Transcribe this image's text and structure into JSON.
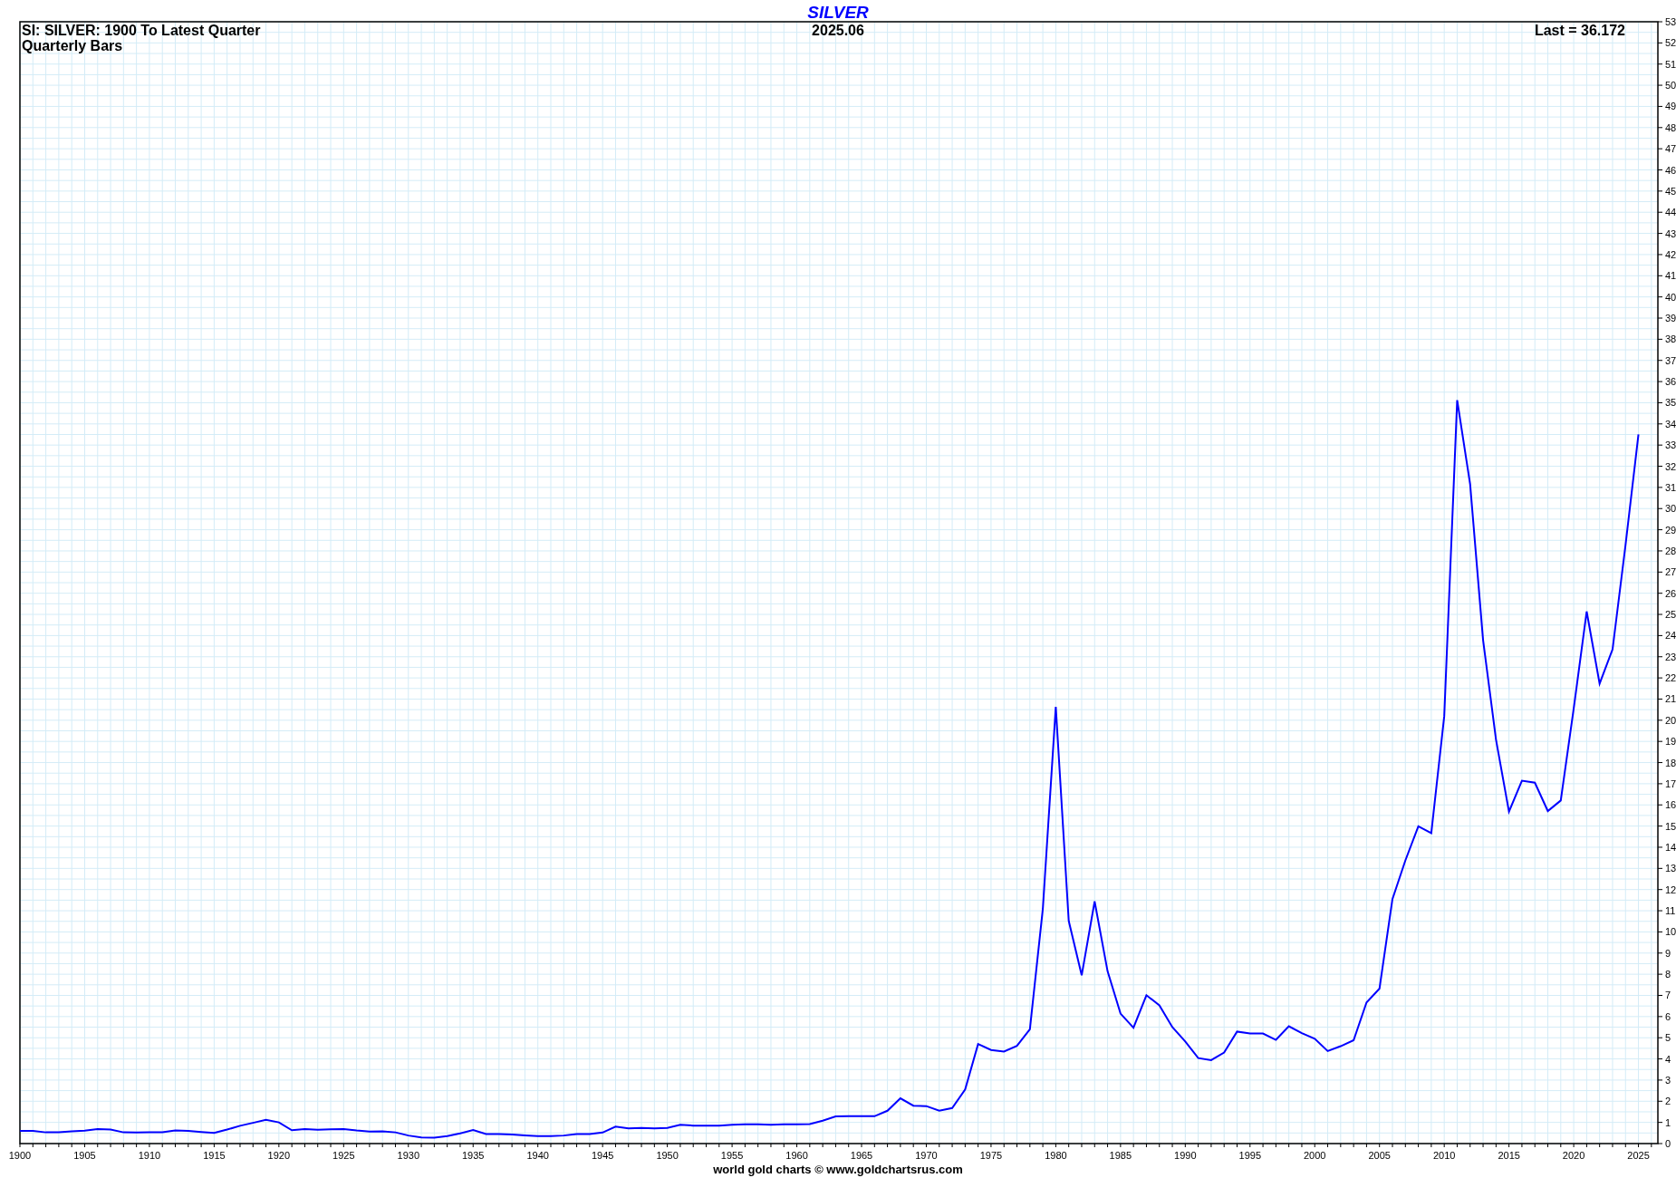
{
  "header": {
    "lines": [
      "SI: SILVER: 1900 To Latest Quarter",
      "Quarterly Bars"
    ],
    "date": "2025.06",
    "last": "Last = 36.172"
  },
  "chart_data": {
    "type": "line",
    "title": "SILVER",
    "x": [
      1900,
      1901,
      1902,
      1903,
      1904,
      1905,
      1906,
      1907,
      1908,
      1909,
      1910,
      1911,
      1912,
      1913,
      1914,
      1915,
      1916,
      1917,
      1918,
      1919,
      1920,
      1921,
      1922,
      1923,
      1924,
      1925,
      1926,
      1927,
      1928,
      1929,
      1930,
      1931,
      1932,
      1933,
      1934,
      1935,
      1936,
      1937,
      1938,
      1939,
      1940,
      1941,
      1942,
      1943,
      1944,
      1945,
      1946,
      1947,
      1948,
      1949,
      1950,
      1951,
      1952,
      1953,
      1954,
      1955,
      1956,
      1957,
      1958,
      1959,
      1960,
      1961,
      1962,
      1963,
      1964,
      1965,
      1966,
      1967,
      1968,
      1969,
      1970,
      1971,
      1972,
      1973,
      1974,
      1975,
      1976,
      1977,
      1978,
      1979,
      1980,
      1981,
      1982,
      1983,
      1984,
      1985,
      1986,
      1987,
      1988,
      1989,
      1990,
      1991,
      1992,
      1993,
      1994,
      1995,
      1996,
      1997,
      1998,
      1999,
      2000,
      2001,
      2002,
      2003,
      2004,
      2005,
      2006,
      2007,
      2008,
      2009,
      2010,
      2011,
      2012,
      2013,
      2014,
      2015,
      2016,
      2017,
      2018,
      2019,
      2020,
      2021,
      2022,
      2023,
      2024,
      2025
    ],
    "series": [
      {
        "color": "#0000ff",
        "values": [
          0.6,
          0.6,
          0.53,
          0.54,
          0.58,
          0.61,
          0.68,
          0.66,
          0.53,
          0.52,
          0.54,
          0.54,
          0.62,
          0.6,
          0.55,
          0.5,
          0.66,
          0.84,
          0.98,
          1.12,
          1.0,
          0.63,
          0.68,
          0.65,
          0.67,
          0.69,
          0.62,
          0.57,
          0.58,
          0.53,
          0.38,
          0.29,
          0.28,
          0.35,
          0.48,
          0.64,
          0.45,
          0.45,
          0.43,
          0.39,
          0.35,
          0.35,
          0.38,
          0.45,
          0.45,
          0.52,
          0.8,
          0.72,
          0.74,
          0.72,
          0.74,
          0.89,
          0.85,
          0.85,
          0.85,
          0.89,
          0.91,
          0.91,
          0.89,
          0.91,
          0.91,
          0.92,
          1.08,
          1.28,
          1.29,
          1.29,
          1.29,
          1.55,
          2.14,
          1.79,
          1.77,
          1.55,
          1.68,
          2.56,
          4.7,
          4.42,
          4.35,
          4.62,
          5.4,
          11.09,
          20.63,
          10.52,
          7.95,
          11.44,
          8.14,
          6.14,
          5.47,
          7.01,
          6.53,
          5.5,
          4.82,
          4.04,
          3.94,
          4.3,
          5.29,
          5.2,
          5.2,
          4.9,
          5.54,
          5.22,
          4.95,
          4.37,
          4.6,
          4.88,
          6.67,
          7.32,
          11.55,
          13.38,
          14.99,
          14.67,
          20.19,
          35.12,
          31.15,
          23.79,
          19.08,
          15.68,
          17.14,
          17.05,
          15.71,
          16.21,
          20.55,
          25.14,
          21.73,
          23.35,
          28.27,
          33.5
        ]
      }
    ],
    "grid": true,
    "xlim": [
      1900,
      2026.5
    ],
    "ylim": [
      0,
      53
    ],
    "xticks": [
      1900,
      1905,
      1910,
      1915,
      1920,
      1925,
      1930,
      1935,
      1940,
      1945,
      1950,
      1955,
      1960,
      1965,
      1970,
      1975,
      1980,
      1985,
      1990,
      1995,
      2000,
      2005,
      2010,
      2015,
      2020,
      2025
    ],
    "yticks": [
      0,
      1,
      2,
      3,
      4,
      5,
      6,
      7,
      8,
      9,
      10,
      11,
      12,
      13,
      14,
      15,
      16,
      17,
      18,
      19,
      20,
      21,
      22,
      23,
      24,
      25,
      26,
      27,
      28,
      29,
      30,
      31,
      32,
      33,
      34,
      35,
      36,
      37,
      38,
      39,
      40,
      41,
      42,
      43,
      44,
      45,
      46,
      47,
      48,
      49,
      50,
      51,
      52,
      53
    ]
  },
  "footer": "world gold charts © www.goldchartsrus.com"
}
